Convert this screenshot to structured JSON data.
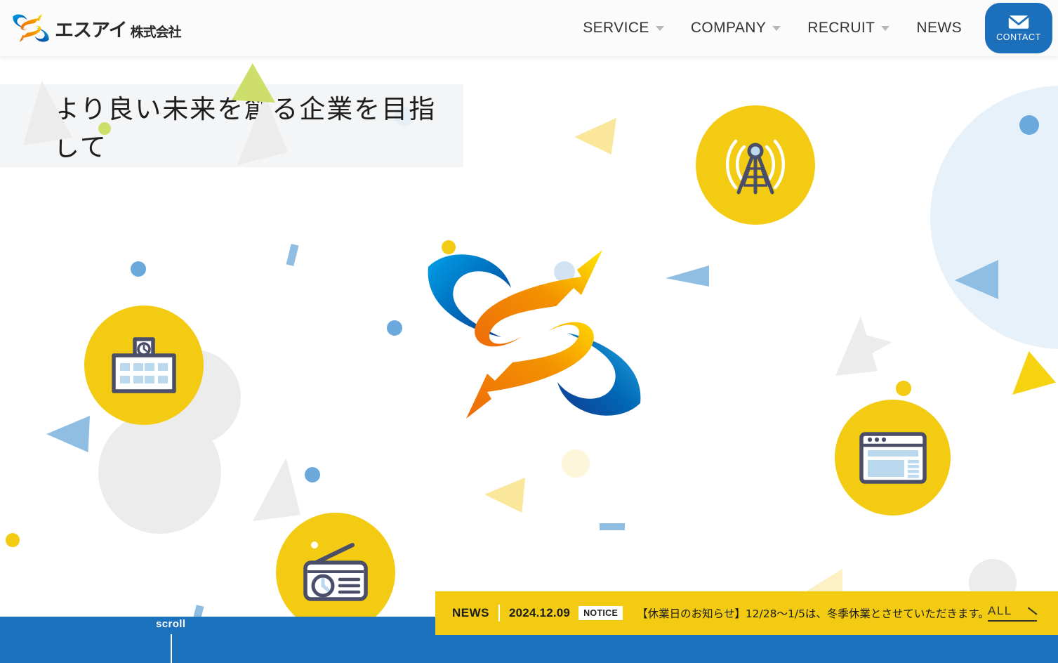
{
  "header": {
    "logo": {
      "mark": "s-swoosh-logo",
      "kana": "エスアイ",
      "suffix": "株式会社"
    },
    "nav": [
      {
        "label": "SERVICE",
        "has_dropdown": true
      },
      {
        "label": "COMPANY",
        "has_dropdown": true
      },
      {
        "label": "RECRUIT",
        "has_dropdown": true
      },
      {
        "label": "NEWS",
        "has_dropdown": false
      }
    ],
    "contact": {
      "label": "CONTACT",
      "icon": "envelope-icon",
      "color": "#1c6fba"
    }
  },
  "hero": {
    "headline": "より良い未来を創る企業を目指して",
    "center_logo": "s-swoosh-logo-large",
    "feature_icons": [
      {
        "name": "school-building-icon",
        "circle_color": "#F2CB12"
      },
      {
        "name": "radio-icon",
        "circle_color": "#F2CB12"
      },
      {
        "name": "broadcast-tower-icon",
        "circle_color": "#F2CB12"
      },
      {
        "name": "browser-window-icon",
        "circle_color": "#F2CB12"
      }
    ]
  },
  "news": {
    "label": "NEWS",
    "date": "2024.12.09",
    "tag": "NOTICE",
    "title": "【休業日のお知らせ】12/28〜1/5は、冬季休業とさせていただきます。",
    "all_label": "ALL",
    "bar_color": "#F2CB12"
  },
  "footer": {
    "scroll_label": "scroll",
    "bar_color": "#1c72bc"
  },
  "palette": {
    "yellow": "#F2CB12",
    "pale_yellow": "#FAE79B",
    "blue": "#6BA9DC",
    "pale_blue": "#D3E3F3",
    "light_blue_circle": "#E7F1FA",
    "orange": "#ED6C0B",
    "deep_blue": "#1C6FBA",
    "gray": "#ececec",
    "green": "#CDDE6B"
  }
}
